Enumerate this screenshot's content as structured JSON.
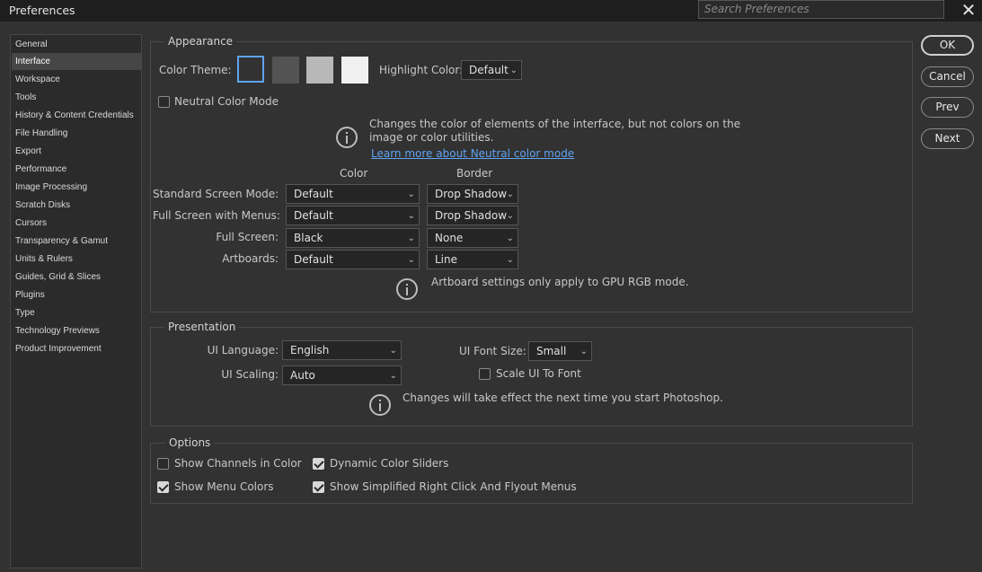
{
  "window": {
    "title": "Preferences",
    "search_placeholder": "Search Preferences"
  },
  "sidebar": {
    "items": [
      "General",
      "Interface",
      "Workspace",
      "Tools",
      "History & Content Credentials",
      "File Handling",
      "Export",
      "Performance",
      "Image Processing",
      "Scratch Disks",
      "Cursors",
      "Transparency & Gamut",
      "Units & Rulers",
      "Guides, Grid & Slices",
      "Plugins",
      "Type",
      "Technology Previews",
      "Product Improvement"
    ],
    "selected": "Interface"
  },
  "appearance": {
    "title": "Appearance",
    "color_theme_label": "Color Theme:",
    "theme_swatches": [
      "#323232",
      "#535353",
      "#b8b8b8",
      "#f0f0f0"
    ],
    "selected_theme": 0,
    "highlight_label": "Highlight Color:",
    "highlight_value": "Default",
    "neutral_label": "Neutral Color Mode",
    "neutral_checked": false,
    "neutral_info_line1": "Changes the color of elements of the interface, but not colors on the",
    "neutral_info_line2": "image or color utilities.",
    "neutral_link": "Learn more about Neutral color mode",
    "col_color": "Color",
    "col_border": "Border",
    "modes": [
      {
        "label": "Standard Screen Mode:",
        "color": "Default",
        "border": "Drop Shadow"
      },
      {
        "label": "Full Screen with Menus:",
        "color": "Default",
        "border": "Drop Shadow"
      },
      {
        "label": "Full Screen:",
        "color": "Black",
        "border": "None"
      },
      {
        "label": "Artboards:",
        "color": "Default",
        "border": "Line"
      }
    ],
    "artboard_info": "Artboard settings only apply to GPU RGB mode."
  },
  "presentation": {
    "title": "Presentation",
    "ui_language_label": "UI Language:",
    "ui_language_value": "English",
    "ui_font_size_label": "UI Font Size:",
    "ui_font_size_value": "Small",
    "ui_scaling_label": "UI Scaling:",
    "ui_scaling_value": "Auto",
    "scale_ui_label": "Scale UI To Font",
    "scale_ui_checked": false,
    "info": "Changes will take effect the next time you start Photoshop."
  },
  "options": {
    "title": "Options",
    "items": [
      {
        "label": "Show Channels in Color",
        "checked": false
      },
      {
        "label": "Dynamic Color Sliders",
        "checked": true
      },
      {
        "label": "Show Menu Colors",
        "checked": true
      },
      {
        "label": "Show Simplified Right Click And Flyout Menus",
        "checked": true
      }
    ]
  },
  "buttons": {
    "ok": "OK",
    "cancel": "Cancel",
    "prev": "Prev",
    "next": "Next"
  },
  "colors": {
    "accent": "#5fa3f0",
    "background": "#323232",
    "sidebar_selected": "#464646"
  }
}
